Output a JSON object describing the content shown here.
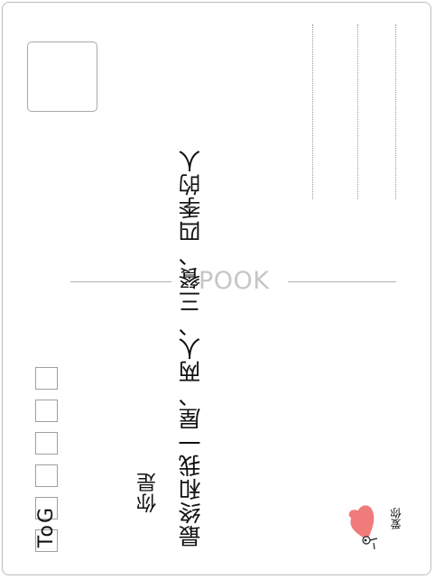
{
  "postcard": {
    "main_text": "最终和我一屋、两人、三餐、四季的人",
    "name_text": "你是",
    "to_label": "ToG",
    "watermark": "POOK",
    "love_text": "爱你"
  },
  "icons": {
    "heart": "heart-icon",
    "doodle": "doodle-figure-icon"
  },
  "colors": {
    "heart": "#f07b7b",
    "border": "#bdbdbd",
    "watermark": "#c6c6c6"
  }
}
